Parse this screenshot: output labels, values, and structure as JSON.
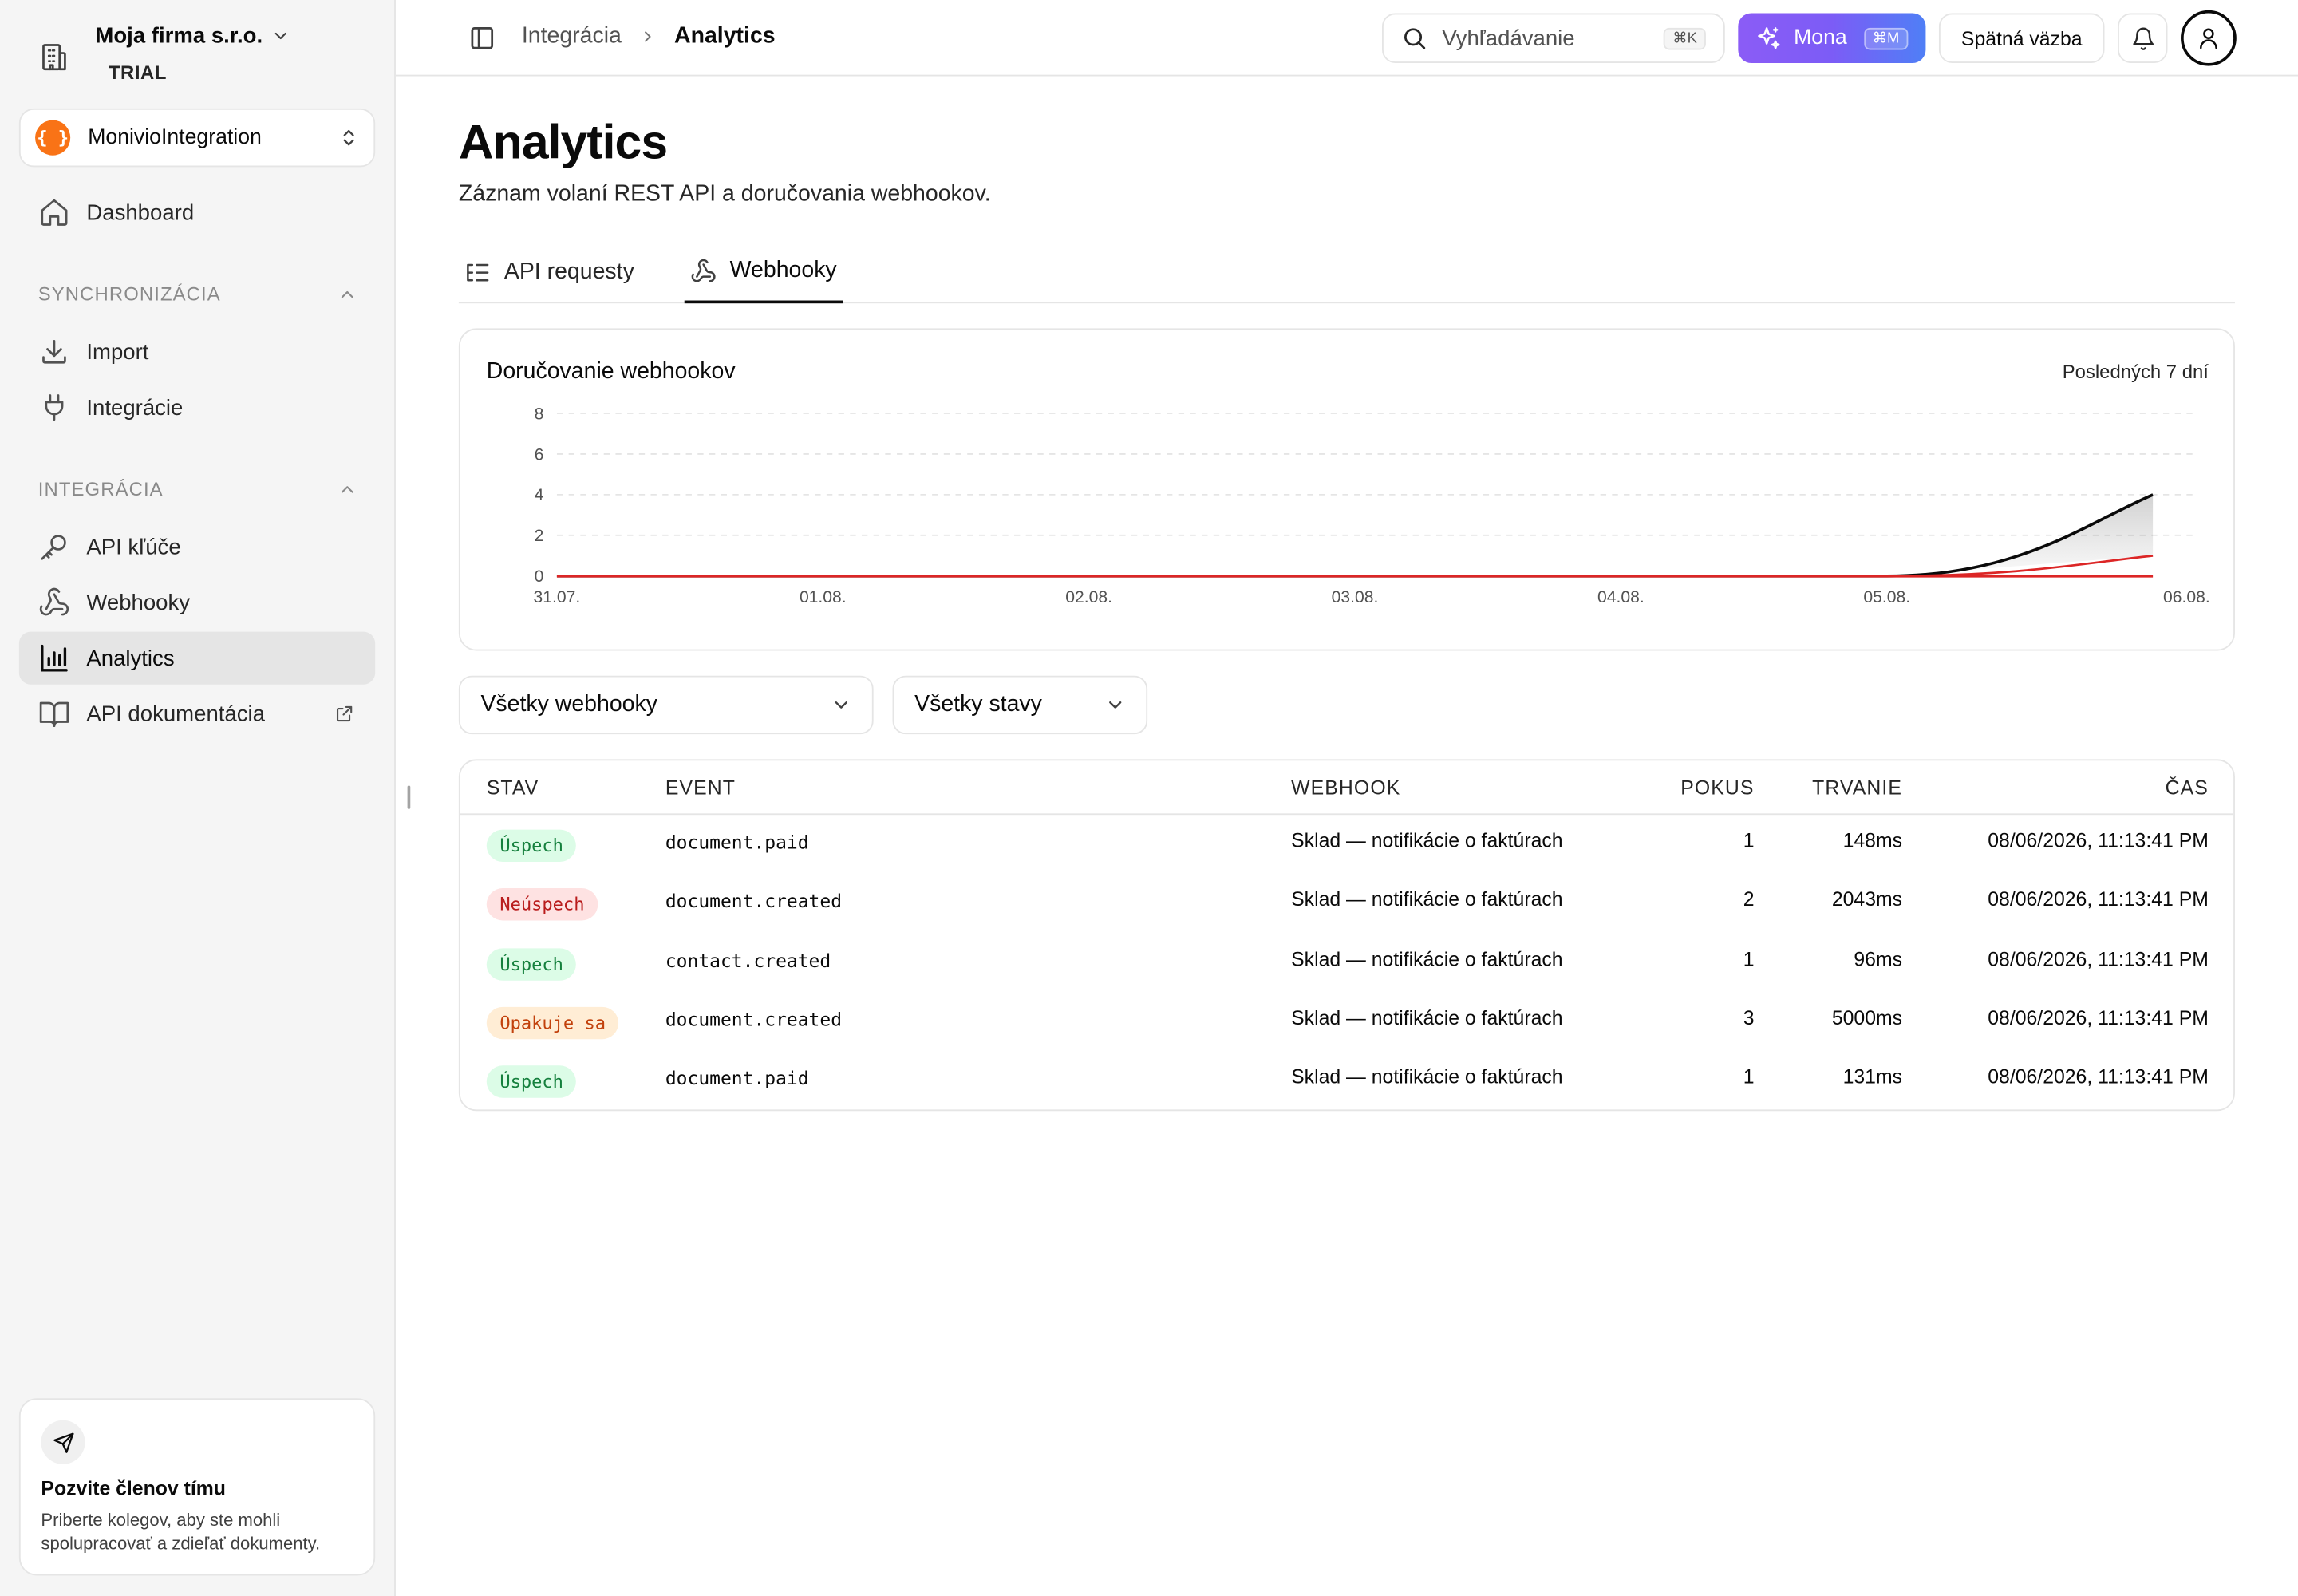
{
  "company": {
    "name": "Moja firma s.r.o.",
    "plan": "TRIAL"
  },
  "workspace": {
    "logo": "{ }",
    "name": "MonivioIntegration"
  },
  "sidebar": {
    "dashboard": "Dashboard",
    "section_sync": "SYNCHRONIZÁCIA",
    "import": "Import",
    "integrations": "Integrácie",
    "section_integration": "INTEGRÁCIA",
    "api_keys": "API kľúče",
    "webhooks": "Webhooky",
    "analytics": "Analytics",
    "api_docs": "API dokumentácia"
  },
  "invite": {
    "title": "Pozvite členov tímu",
    "desc": "Priberte kolegov, aby ste mohli spolupracovať a zdieľať dokumenty."
  },
  "topbar": {
    "crumb_parent": "Integrácia",
    "crumb_current": "Analytics",
    "search_placeholder": "Vyhľadávanie",
    "search_kbd": "⌘K",
    "mona_label": "Mona",
    "mona_kbd": "⌘M",
    "feedback": "Spätná väzba"
  },
  "page": {
    "title": "Analytics",
    "subtitle": "Záznam volaní REST API a doručovania webhookov."
  },
  "tabs": [
    {
      "label": "API requesty",
      "icon": "list-icon"
    },
    {
      "label": "Webhooky",
      "icon": "webhook-icon",
      "active": true
    }
  ],
  "chart_data": {
    "type": "area",
    "title": "Doručovanie webhookov",
    "range_label": "Posledných 7 dní",
    "categories": [
      "31.07.",
      "01.08.",
      "02.08.",
      "03.08.",
      "04.08.",
      "05.08.",
      "06.08."
    ],
    "yticks": [
      0,
      2,
      4,
      6,
      8
    ],
    "ylim": [
      0,
      8
    ],
    "grid": true,
    "series": [
      {
        "values": [
          0,
          0,
          0,
          0,
          0,
          0,
          4
        ],
        "color": "#0a0a0a",
        "fill": true
      },
      {
        "values": [
          0,
          0,
          0,
          0,
          0,
          0,
          1
        ],
        "color": "#dc2626",
        "fill": false
      }
    ]
  },
  "filters": {
    "webhook": "Všetky webhooky",
    "status": "Všetky stavy"
  },
  "table": {
    "headers": {
      "status": "STAV",
      "event": "EVENT",
      "webhook": "WEBHOOK",
      "attempt": "POKUS",
      "duration": "TRVANIE",
      "time": "ČAS"
    },
    "rows": [
      {
        "status": "Úspech",
        "status_type": "ok",
        "event": "document.paid",
        "webhook": "Sklad — notifikácie o faktúrach",
        "attempt": "1",
        "duration": "148ms",
        "time": "08/06/2026, 11:13:41 PM"
      },
      {
        "status": "Neúspech",
        "status_type": "fail",
        "event": "document.created",
        "webhook": "Sklad — notifikácie o faktúrach",
        "attempt": "2",
        "duration": "2043ms",
        "time": "08/06/2026, 11:13:41 PM"
      },
      {
        "status": "Úspech",
        "status_type": "ok",
        "event": "contact.created",
        "webhook": "Sklad — notifikácie o faktúrach",
        "attempt": "1",
        "duration": "96ms",
        "time": "08/06/2026, 11:13:41 PM"
      },
      {
        "status": "Opakuje sa",
        "status_type": "retry",
        "event": "document.created",
        "webhook": "Sklad — notifikácie o faktúrach",
        "attempt": "3",
        "duration": "5000ms",
        "time": "08/06/2026, 11:13:41 PM"
      },
      {
        "status": "Úspech",
        "status_type": "ok",
        "event": "document.paid",
        "webhook": "Sklad — notifikácie o faktúrach",
        "attempt": "1",
        "duration": "131ms",
        "time": "08/06/2026, 11:13:41 PM"
      }
    ]
  }
}
